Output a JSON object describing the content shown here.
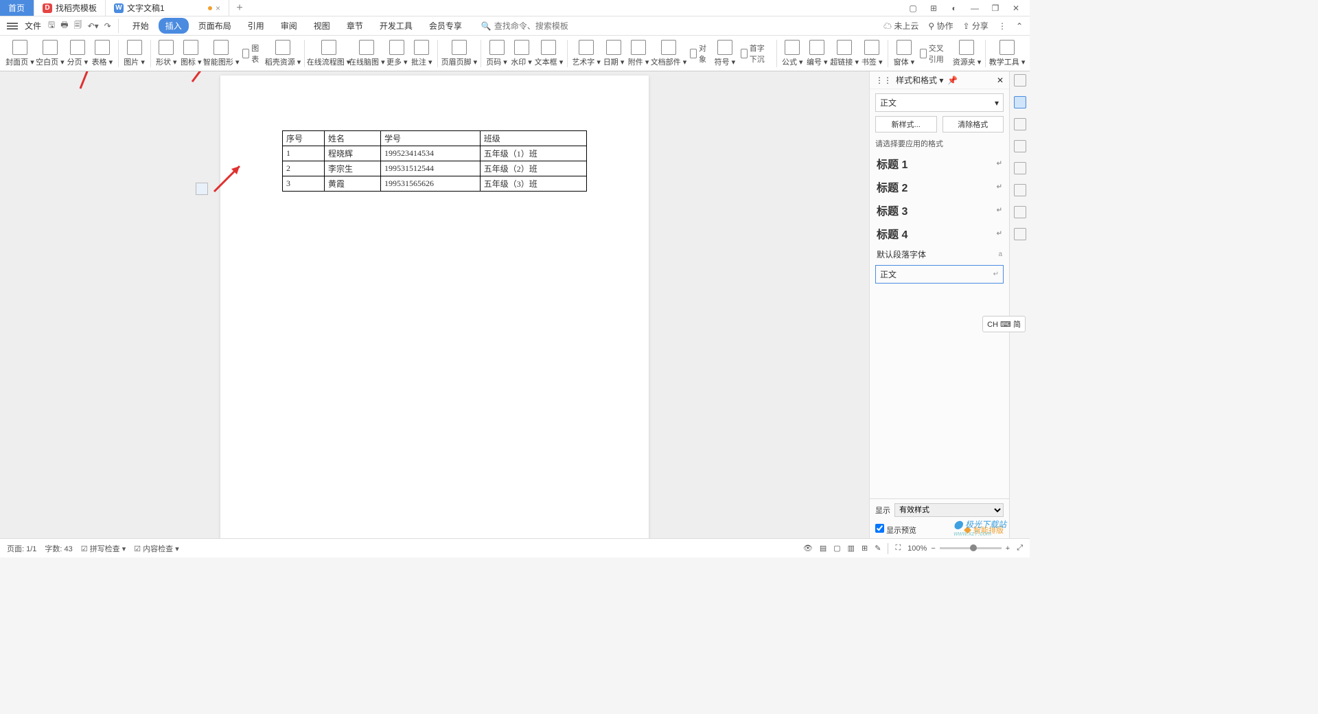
{
  "tabs": {
    "home": "首页",
    "t1": "找稻壳模板",
    "t2": "文字文稿1",
    "close": "×",
    "add": "+"
  },
  "menu": {
    "file": "文件",
    "items": [
      "开始",
      "插入",
      "页面布局",
      "引用",
      "审阅",
      "视图",
      "章节",
      "开发工具",
      "会员专享"
    ],
    "active_index": 1,
    "search_placeholder": "查找命令、搜索模板",
    "right": {
      "cloud": "未上云",
      "coop": "协作",
      "share": "分享"
    }
  },
  "ribbon": {
    "items": [
      "封面页",
      "空白页",
      "分页",
      "表格",
      "图片",
      "形状",
      "图标",
      "智能图形",
      "稻壳资源",
      "在线流程图",
      "在线脑图",
      "更多",
      "批注",
      "页眉页脚",
      "页码",
      "水印",
      "文本框",
      "艺术字",
      "日期",
      "附件",
      "文档部件",
      "符号",
      "公式",
      "编号",
      "超链接",
      "书签",
      "窗体",
      "资源夹",
      "教学工具"
    ],
    "side": {
      "chart": "图表",
      "object": "对象",
      "dropcap": "首字下沉",
      "crossref": "交叉引用"
    }
  },
  "table": {
    "headers": [
      "序号",
      "姓名",
      "学号",
      "班级"
    ],
    "rows": [
      [
        "1",
        "程晓辉",
        "199523414534",
        "五年级（1）班"
      ],
      [
        "2",
        "李宗生",
        "199531512544",
        "五年级（2）班"
      ],
      [
        "3",
        "黄霞",
        "199531565626",
        "五年级（3）班"
      ]
    ]
  },
  "panel": {
    "title": "样式和格式",
    "current": "正文",
    "new_btn": "新样式...",
    "clear_btn": "清除格式",
    "apply_label": "请选择要应用的格式",
    "styles": [
      "标题 1",
      "标题 2",
      "标题 3",
      "标题 4"
    ],
    "default_font": "默认段落字体",
    "normal": "正文",
    "display": "显示",
    "display_val": "有效样式",
    "preview": "显示预览",
    "smart": "智能排版"
  },
  "status": {
    "page": "页面: 1/1",
    "words": "字数: 43",
    "spell": "拼写检查",
    "content": "内容检查",
    "zoom": "100%"
  },
  "ime": "CH ⌨ 简",
  "watermark": {
    "main": "极光下载站",
    "sub": "www.xz7.com"
  }
}
